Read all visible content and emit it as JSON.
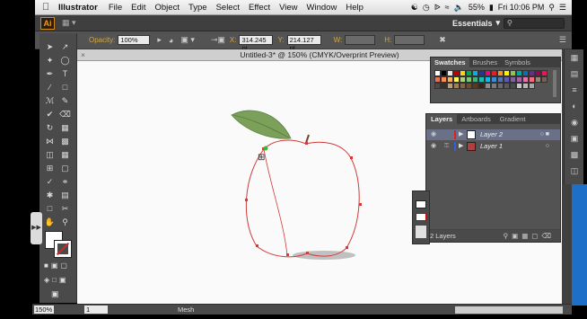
{
  "menubar": {
    "apple": "",
    "app_name": "Illustrator",
    "items": [
      "File",
      "Edit",
      "Object",
      "Type",
      "Select",
      "Effect",
      "View",
      "Window",
      "Help"
    ],
    "battery": "55%",
    "clock": "Fri 10:06 PM"
  },
  "appbar": {
    "logo": "Ai",
    "workspace": "Essentials",
    "search_placeholder": ""
  },
  "control": {
    "opacity_label": "Opacity:",
    "opacity_value": "100%",
    "x_label": "X:",
    "x_value": "314.245 pt",
    "y_label": "Y:",
    "y_value": "214.127 pt",
    "w_label": "W:",
    "h_label": "H:"
  },
  "document": {
    "tab_title": "Untitled-3* @ 150% (CMYK/Overprint Preview)"
  },
  "swatches": {
    "tabs": [
      "Swatches",
      "Brushes",
      "Symbols"
    ],
    "colors": [
      "#ffffff",
      "#000000",
      "#e8e8e8",
      "#c00000",
      "#ffd500",
      "#00a650",
      "#00aeef",
      "#2e3192",
      "#ec008c",
      "#ed1c24",
      "#f7941d",
      "#fff200",
      "#8dc63f",
      "#00a99d",
      "#0072bc",
      "#662d91",
      "#9e005d",
      "#ed145b",
      "#f26c4f",
      "#f68e56",
      "#fbaf5d",
      "#fff568",
      "#acd373",
      "#7cc576",
      "#3bb878",
      "#1abbb4",
      "#00bff3",
      "#438ccb",
      "#5574b9",
      "#605ca8",
      "#855fa8",
      "#a763a8",
      "#f06ea9",
      "#f26d7d",
      "#998675",
      "#736357",
      "#534741",
      "#37302a",
      "#c69c6d",
      "#a67c52",
      "#8c6239",
      "#754c24",
      "#603913",
      "#3c2415",
      "#8a8a8a",
      "#7a7a7a",
      "#6a6a6a",
      "#5a5a5a",
      "#4a4a4a",
      "#c7c7c7",
      "#b7b7b7",
      "#a7a7a7"
    ]
  },
  "layers": {
    "tabs": [
      "Layers",
      "Artboards",
      "Gradient"
    ],
    "rows": [
      {
        "name": "Layer 2",
        "color": "#e02020"
      },
      {
        "name": "Layer 1",
        "color": "#3060e0"
      }
    ],
    "count": "2 Layers"
  },
  "status": {
    "zoom": "150%",
    "page": "1",
    "mode": "Mesh"
  }
}
